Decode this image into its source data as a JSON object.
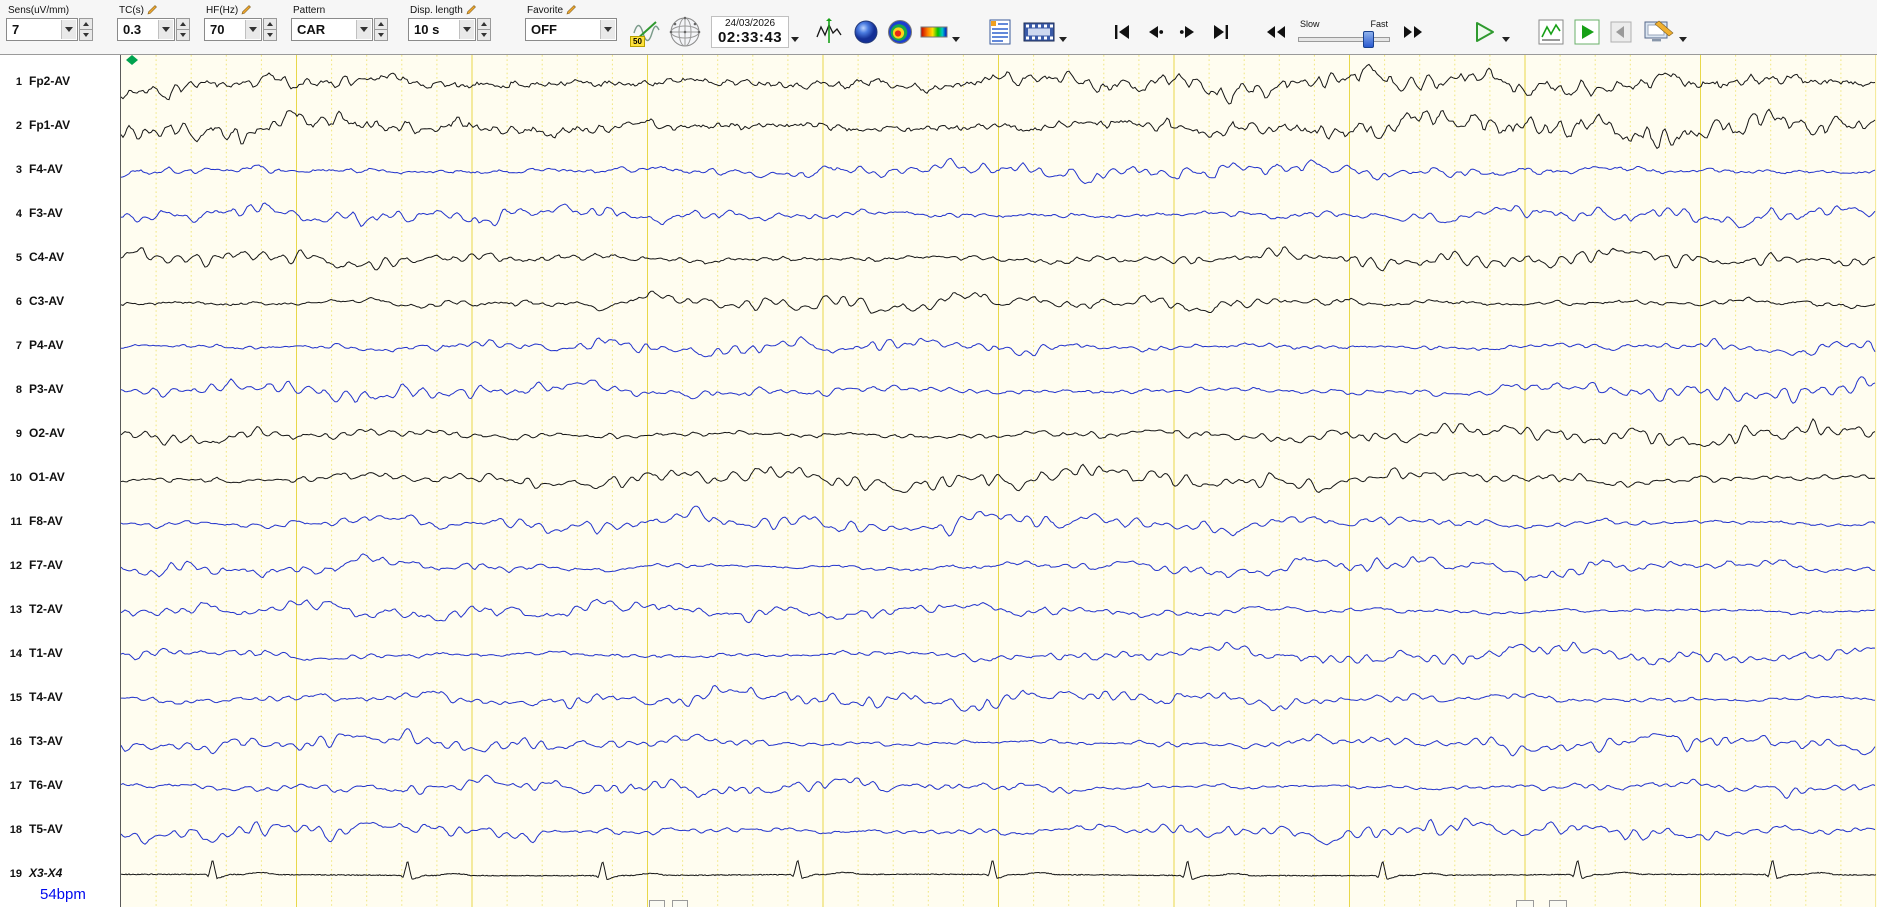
{
  "toolbar": {
    "sens": {
      "label": "Sens(uV/mm)",
      "value": "7"
    },
    "tc": {
      "label": "TC(s)",
      "value": "0.3"
    },
    "hf": {
      "label": "HF(Hz)",
      "value": "70"
    },
    "pattern": {
      "label": "Pattern",
      "value": "CAR"
    },
    "disp_length": {
      "label": "Disp. length",
      "value": "10 s"
    },
    "favorite": {
      "label": "Favorite",
      "value": "OFF"
    },
    "notch_badge": "50",
    "datetime": {
      "date": "24/03/2026",
      "time": "02:33:43"
    },
    "speed_slider": {
      "slow": "Slow",
      "fast": "Fast"
    },
    "icons": [
      "edit-pencil-icon",
      "notch-filter-icon",
      "electrode-map-icon",
      "trace-overview-icon",
      "dsa-sphere-icon",
      "topo-map-icon",
      "color-scale-icon",
      "patient-info-icon",
      "video-icon",
      "jump-start-icon",
      "page-back-icon",
      "page-forward-icon",
      "jump-end-icon",
      "rewind-icon",
      "fast-forward-icon",
      "play-icon",
      "trend-chart-icon",
      "review-play-icon",
      "prev-disabled-icon",
      "montage-settings-icon"
    ]
  },
  "channels": [
    {
      "num": "1",
      "label": "Fp2-AV",
      "color": "black",
      "type": "frontal"
    },
    {
      "num": "2",
      "label": "Fp1-AV",
      "color": "black",
      "type": "frontal"
    },
    {
      "num": "3",
      "label": "F4-AV",
      "color": "blue",
      "type": "central"
    },
    {
      "num": "4",
      "label": "F3-AV",
      "color": "blue",
      "type": "central"
    },
    {
      "num": "5",
      "label": "C4-AV",
      "color": "black",
      "type": "central"
    },
    {
      "num": "6",
      "label": "C3-AV",
      "color": "black",
      "type": "central"
    },
    {
      "num": "7",
      "label": "P4-AV",
      "color": "blue",
      "type": "parietal"
    },
    {
      "num": "8",
      "label": "P3-AV",
      "color": "blue",
      "type": "parietal"
    },
    {
      "num": "9",
      "label": "O2-AV",
      "color": "black",
      "type": "occipital"
    },
    {
      "num": "10",
      "label": "O1-AV",
      "color": "black",
      "type": "occipital"
    },
    {
      "num": "11",
      "label": "F8-AV",
      "color": "blue",
      "type": "temporal"
    },
    {
      "num": "12",
      "label": "F7-AV",
      "color": "blue",
      "type": "temporal"
    },
    {
      "num": "13",
      "label": "T2-AV",
      "color": "blue",
      "type": "temporal"
    },
    {
      "num": "14",
      "label": "T1-AV",
      "color": "blue",
      "type": "temporal"
    },
    {
      "num": "15",
      "label": "T4-AV",
      "color": "blue",
      "type": "temporal"
    },
    {
      "num": "16",
      "label": "T3-AV",
      "color": "blue",
      "type": "temporal"
    },
    {
      "num": "17",
      "label": "T6-AV",
      "color": "blue",
      "type": "temporal"
    },
    {
      "num": "18",
      "label": "T5-AV",
      "color": "blue",
      "type": "temporal"
    },
    {
      "num": "19",
      "label": "X3-X4",
      "color": "black",
      "type": "ecg",
      "italic": true
    }
  ],
  "heart_rate": "54bpm",
  "display": {
    "seconds": 10,
    "bg": "#fffdf0",
    "grid_major": "#e8d84a",
    "grid_minor": "#f0e67e",
    "trace_black": "#161616",
    "trace_blue": "#2233cc",
    "marker_green": "#00a34f"
  }
}
